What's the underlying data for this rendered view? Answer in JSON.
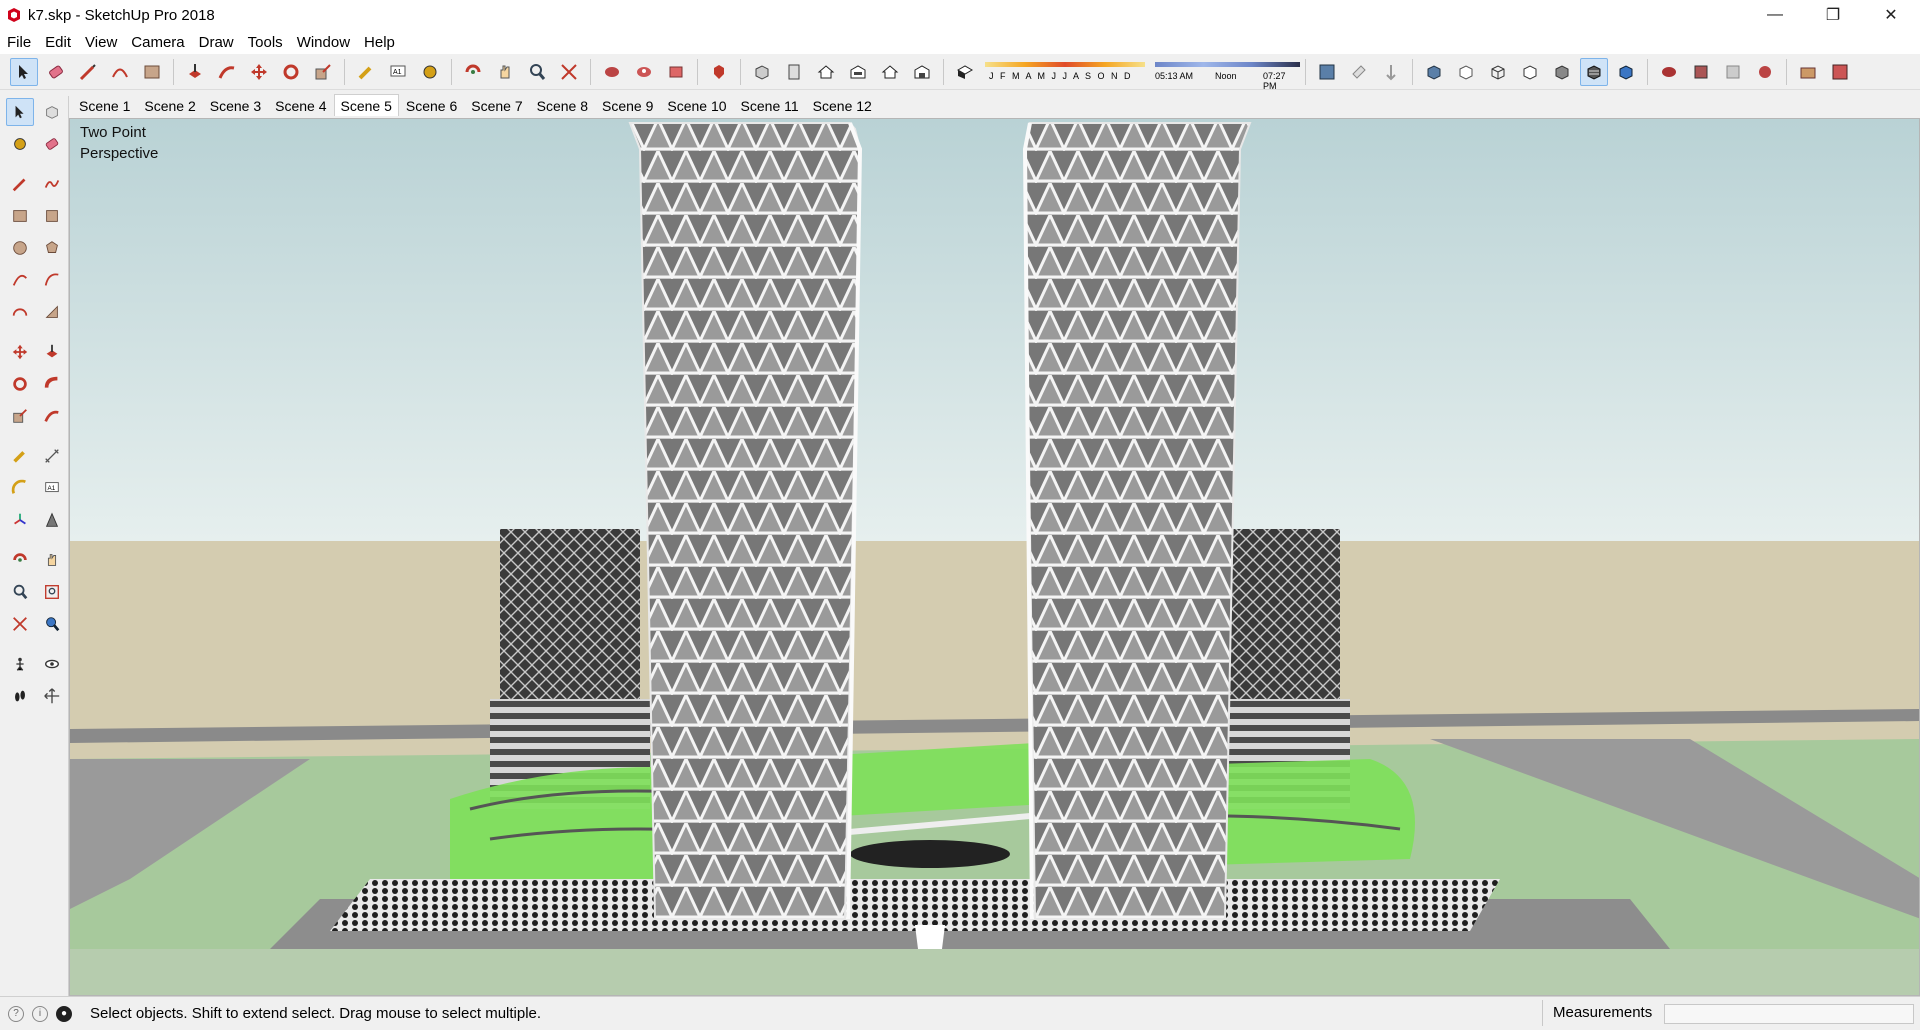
{
  "window": {
    "title": "k7.skp - SketchUp Pro 2018",
    "minimize": "—",
    "maximize": "❐",
    "close": "✕"
  },
  "menu": [
    "File",
    "Edit",
    "View",
    "Camera",
    "Draw",
    "Tools",
    "Window",
    "Help"
  ],
  "shadow": {
    "months_label": "J F M A M J J A S O N D",
    "time_start": "05:13 AM",
    "time_mid": "Noon",
    "time_end": "07:27 PM"
  },
  "scenes": [
    "Scene 1",
    "Scene 2",
    "Scene 3",
    "Scene 4",
    "Scene 5",
    "Scene 6",
    "Scene 7",
    "Scene 8",
    "Scene 9",
    "Scene 10",
    "Scene 11",
    "Scene 12"
  ],
  "active_scene": "Scene 5",
  "camera": {
    "line1": "Two Point",
    "line2": "Perspective"
  },
  "status": {
    "message": "Select objects. Shift to extend select. Drag mouse to select multiple.",
    "measurements_label": "Measurements",
    "measurements_value": ""
  },
  "colors": {
    "sky_top": "#b9d2d5",
    "sky_bottom": "#e6efee",
    "ground": "#d4ccb0",
    "grass": "#a7c99c",
    "bright_green": "#7ee05a",
    "road": "#9a9a9a"
  }
}
